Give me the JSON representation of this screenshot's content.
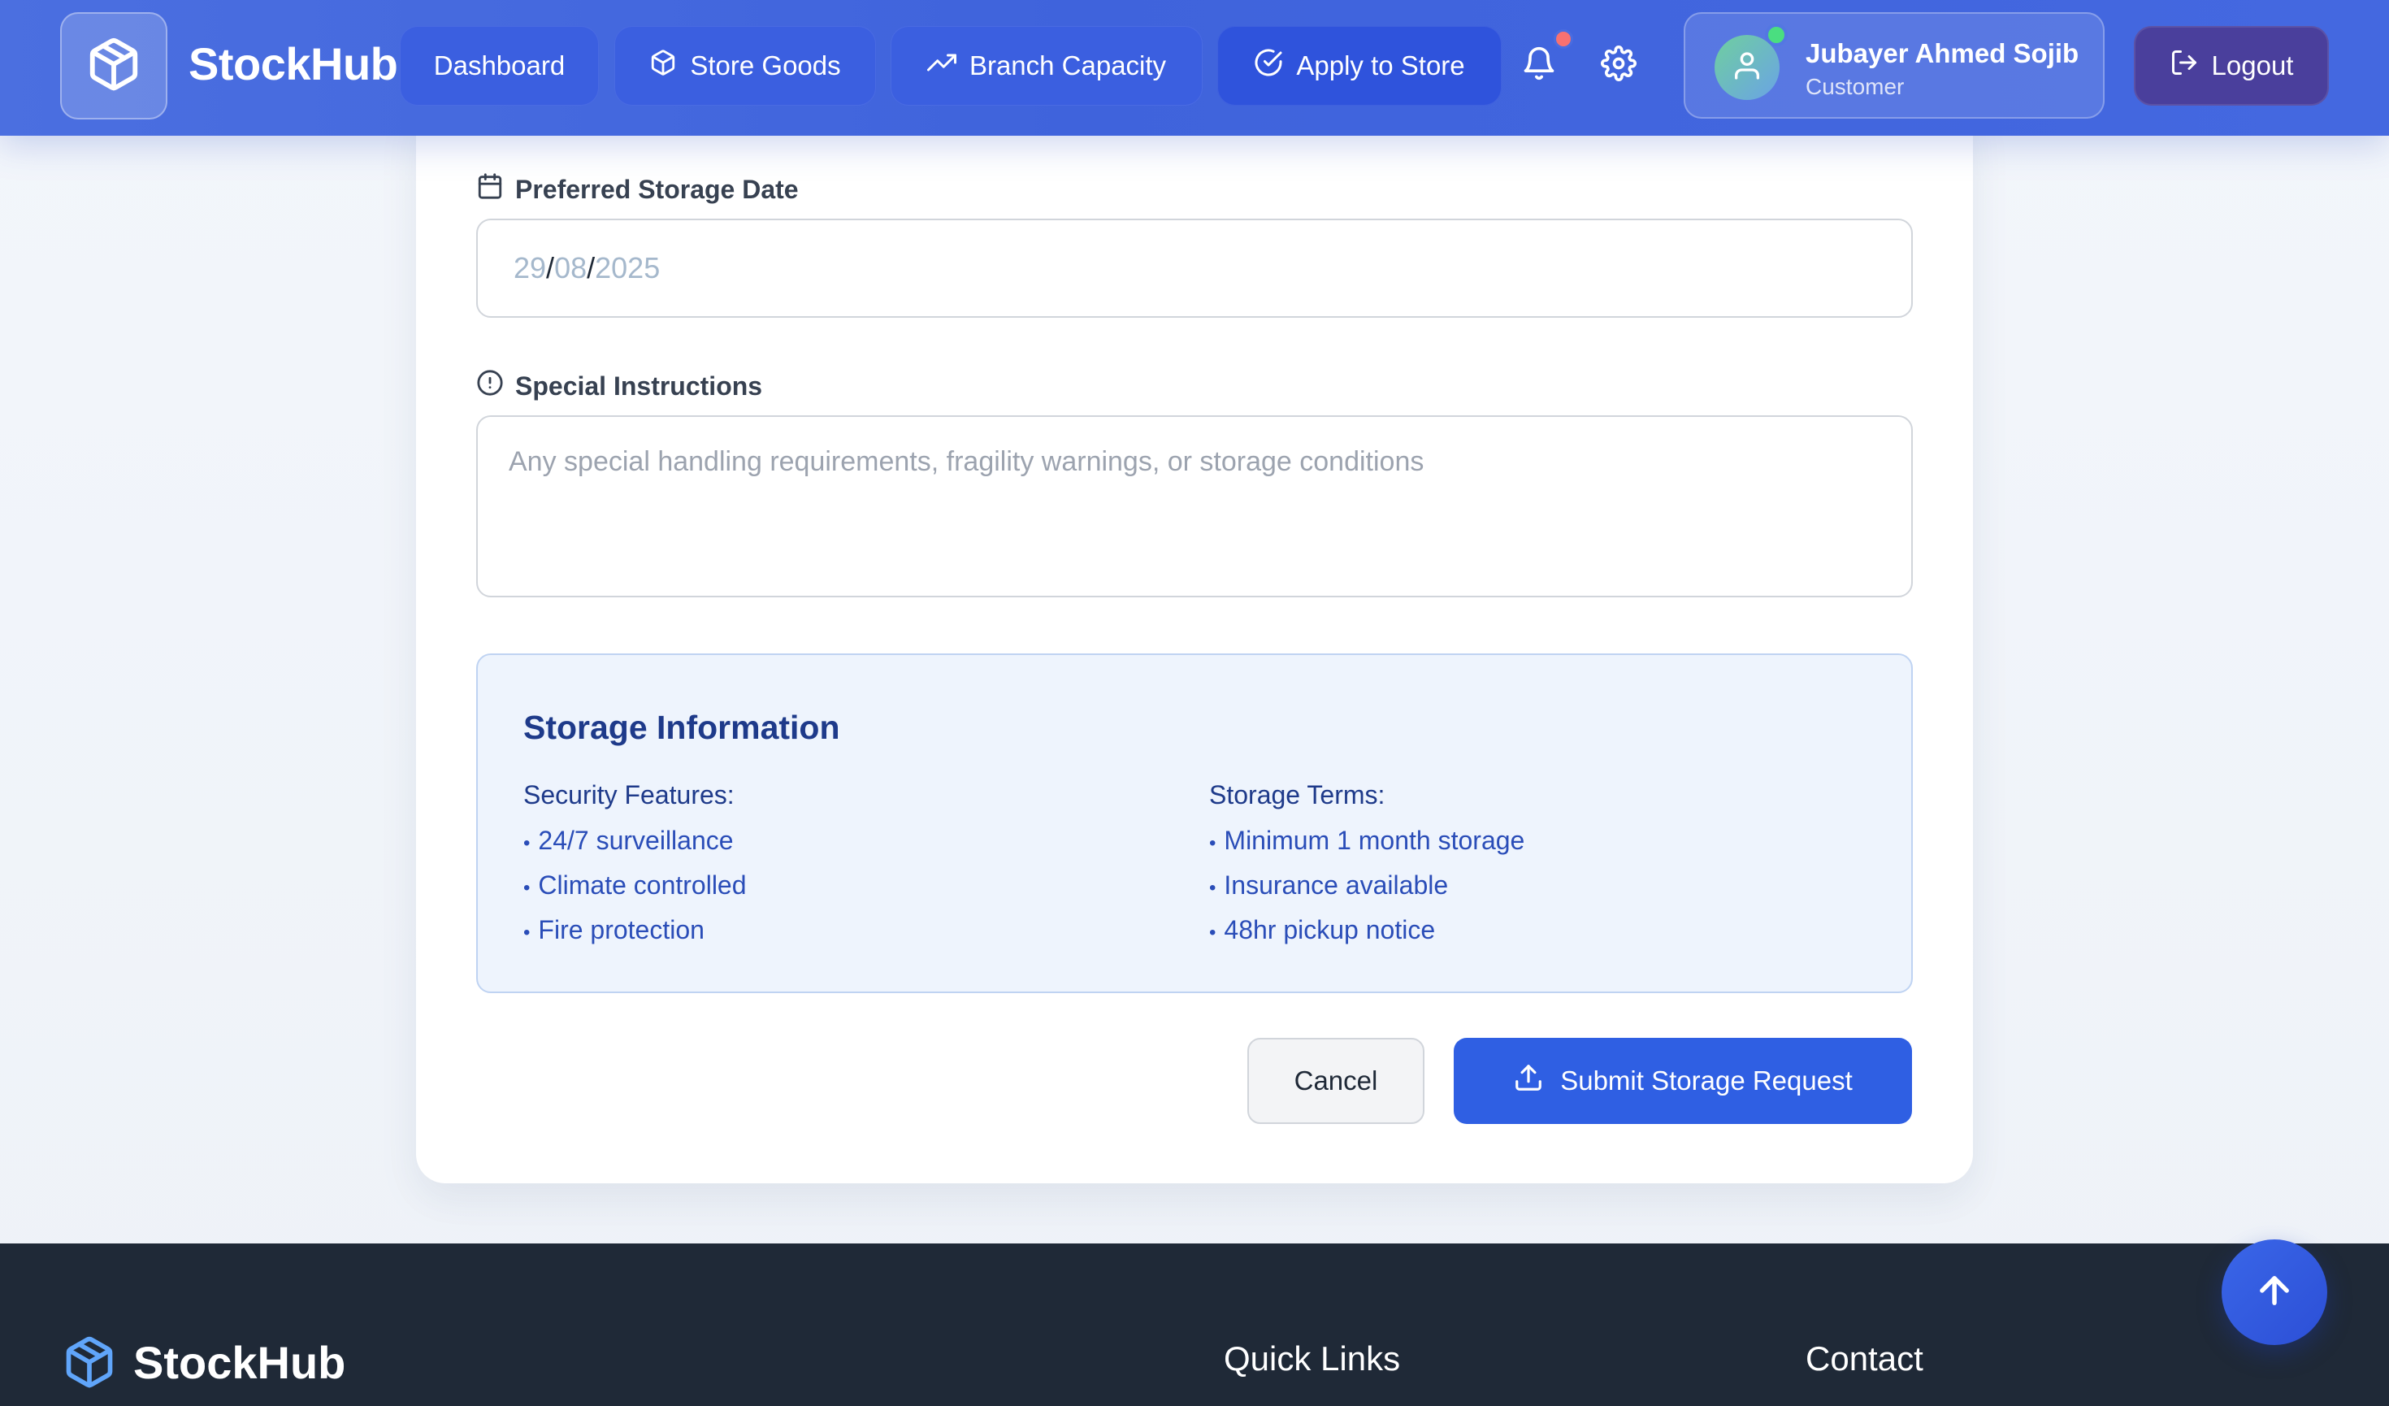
{
  "app": {
    "brand": "StockHub"
  },
  "nav": {
    "dashboard": "Dashboard",
    "store_goods": "Store Goods",
    "branch_capacity": "Branch Capacity",
    "apply_to_store": "Apply to Store"
  },
  "user": {
    "name": "Jubayer Ahmed Sojib",
    "role": "Customer"
  },
  "header_actions": {
    "logout": "Logout"
  },
  "form": {
    "date_label": "Preferred Storage Date",
    "date_day": "29",
    "date_month": "08",
    "date_year": "2025",
    "date_sep": "/",
    "instructions_label": "Special Instructions",
    "instructions_placeholder": "Any special handling requirements, fragility warnings, or storage conditions"
  },
  "info": {
    "title": "Storage Information",
    "security_title": "Security Features:",
    "security_items": [
      "24/7 surveillance",
      "Climate controlled",
      "Fire protection"
    ],
    "terms_title": "Storage Terms:",
    "terms_items": [
      "Minimum 1 month storage",
      "Insurance available",
      "48hr pickup notice"
    ],
    "bullet": "•"
  },
  "actions": {
    "cancel": "Cancel",
    "submit": "Submit Storage Request"
  },
  "footer": {
    "brand": "StockHub",
    "quick_links": "Quick Links",
    "contact": "Contact"
  },
  "colors": {
    "primary": "#3f63dc",
    "accent": "#2f5fe3",
    "footer": "#1f2937",
    "info_bg": "#eef4fd"
  }
}
